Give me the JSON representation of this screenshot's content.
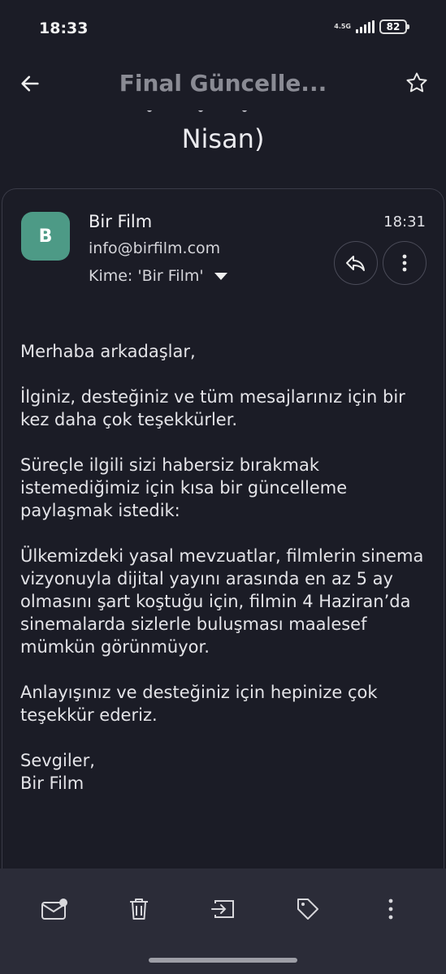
{
  "status": {
    "time": "18:33",
    "network": "4.5G",
    "battery": "82"
  },
  "header": {
    "title": "Final Güncelle...",
    "subject_tail": "Nisan)"
  },
  "message": {
    "avatar_letter": "B",
    "sender_name": "Bir Film",
    "sender_email": "info@birfilm.com",
    "recipient": "Kime: 'Bir Film'",
    "time": "18:31",
    "paragraphs": [
      "Merhaba arkadaşlar,",
      "İlginiz, desteğiniz ve tüm mesajlarınız için bir kez daha çok teşekkürler.",
      "Süreçle ilgili sizi habersiz bırakmak istemediğimiz için kısa bir güncelleme paylaşmak istedik:",
      "Ülkemizdeki yasal mevzuatlar, filmlerin sinema vizyonuyla dijital yayını arasında en az 5 ay olmasını şart koştuğu için, filmin 4 Haziran’da sinemalarda sizlerle buluşması maalesef mümkün görünmüyor.",
      "Anlayışınız ve desteğiniz için hepinize çok teşekkür ederiz."
    ],
    "signature": [
      "Sevgiler,",
      "Bir Film"
    ]
  },
  "bottom_actions": [
    "mark-unread-icon",
    "delete-icon",
    "move-icon",
    "label-icon",
    "more-icon"
  ],
  "colors": {
    "background": "#1b1c26",
    "avatar": "#4d9a86",
    "bottom_bar": "#2b2c38"
  }
}
